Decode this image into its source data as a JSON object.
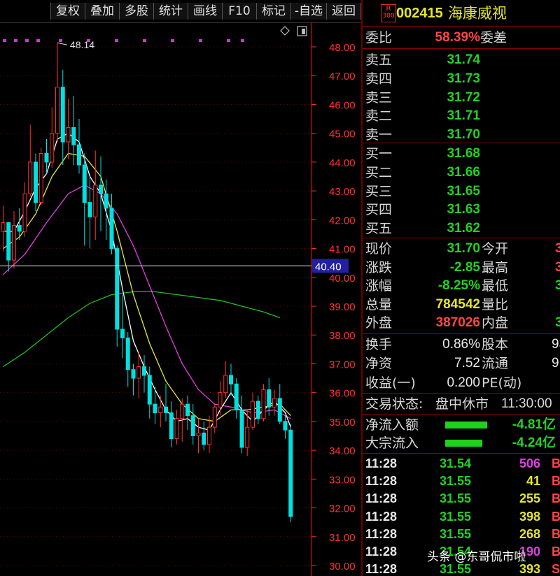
{
  "toolbar": {
    "buttons": [
      "复权",
      "叠加",
      "多股",
      "统计",
      "画线",
      "F10",
      "标记",
      "-自选",
      "返回"
    ]
  },
  "stock": {
    "badge_top": "R",
    "badge_bottom": "300",
    "code": "002415",
    "name": "海康威视"
  },
  "weibi": {
    "label": "委比",
    "value": "58.39%",
    "diff_label": "委差"
  },
  "asks": [
    {
      "label": "卖五",
      "price": "31.74"
    },
    {
      "label": "卖四",
      "price": "31.73"
    },
    {
      "label": "卖三",
      "price": "31.72"
    },
    {
      "label": "卖二",
      "price": "31.71"
    },
    {
      "label": "卖一",
      "price": "31.70"
    }
  ],
  "bids": [
    {
      "label": "买一",
      "price": "31.68"
    },
    {
      "label": "买二",
      "price": "31.66"
    },
    {
      "label": "买三",
      "price": "31.65"
    },
    {
      "label": "买四",
      "price": "31.63"
    },
    {
      "label": "买五",
      "price": "31.62"
    }
  ],
  "quote": [
    {
      "l1": "现价",
      "v1": "31.70",
      "l2": "今开",
      "v2": "3",
      "c1": "green",
      "c2": "red"
    },
    {
      "l1": "涨跌",
      "v1": "-2.85",
      "l2": "最高",
      "v2": "3",
      "c1": "green",
      "c2": "red"
    },
    {
      "l1": "涨幅",
      "v1": "-8.25%",
      "l2": "最低",
      "v2": "3",
      "c1": "green",
      "c2": "green"
    },
    {
      "l1": "总量",
      "v1": "784542",
      "l2": "量比",
      "v2": "",
      "c1": "yellow",
      "c2": "white"
    },
    {
      "l1": "外盘",
      "v1": "387026",
      "l2": "内盘",
      "v2": "39",
      "c1": "red",
      "c2": "green"
    }
  ],
  "fundamentals": [
    {
      "l1": "换手",
      "v1": "0.86%",
      "l2": "股本",
      "v2": "93"
    },
    {
      "l1": "净资",
      "v1": "7.52",
      "l2": "流通",
      "v2": "91"
    },
    {
      "l1": "收益(一)",
      "v1": "0.200",
      "l2": "PE(动)",
      "v2": ""
    }
  ],
  "status": {
    "label": "交易状态:",
    "state": "盘中休市",
    "time": "11:30:00"
  },
  "flows": [
    {
      "label": "净流入额",
      "value": "-4.81亿",
      "fill": 0.85
    },
    {
      "label": "大宗流入",
      "value": "-4.24亿",
      "fill": 0.75
    }
  ],
  "ticks": [
    {
      "time": "11:28",
      "price": "31.54",
      "vol": "506",
      "flag": "B",
      "vc": "magenta"
    },
    {
      "time": "11:28",
      "price": "31.55",
      "vol": "41",
      "flag": "B",
      "vc": "yellow"
    },
    {
      "time": "11:28",
      "price": "31.55",
      "vol": "255",
      "flag": "B",
      "vc": "yellow"
    },
    {
      "time": "11:28",
      "price": "31.55",
      "vol": "398",
      "flag": "B",
      "vc": "yellow"
    },
    {
      "time": "11:28",
      "price": "31.55",
      "vol": "268",
      "flag": "B",
      "vc": "yellow"
    },
    {
      "time": "11:28",
      "price": "31.54",
      "vol": "190",
      "flag": "B",
      "vc": "magenta"
    },
    {
      "time": "11:28",
      "price": "31.55",
      "vol": "393",
      "flag": "S",
      "vc": "yellow"
    }
  ],
  "watermark": "头条 @东哥侃市啦",
  "chart_data": {
    "type": "candlestick",
    "y_ticks": [
      "48.00",
      "47.00",
      "46.00",
      "45.00",
      "44.00",
      "43.00",
      "42.00",
      "41.00",
      "40.00",
      "39.00",
      "38.00",
      "37.00",
      "36.00",
      "35.00",
      "34.00",
      "33.00",
      "32.00",
      "31.00",
      "30.00"
    ],
    "ylim": [
      29.8,
      48.7
    ],
    "max_label": "48.14",
    "crosshair_price": 40.4,
    "crosshair_label": "40.40",
    "colors": {
      "up": "#ff3030",
      "down": "#00e0e0",
      "ma5": "#ffffff",
      "ma10": "#e8e840",
      "ma20": "#e040e0",
      "ma60": "#20c020",
      "grid": "#6b0000",
      "axis": "#ff3030"
    },
    "candles": [
      [
        41.6,
        42.5,
        40.9,
        41.9
      ],
      [
        41.9,
        41.9,
        40.2,
        40.6
      ],
      [
        40.6,
        42.3,
        40.3,
        41.8
      ],
      [
        41.8,
        42.4,
        41.3,
        41.6
      ],
      [
        41.6,
        43.3,
        41.4,
        42.9
      ],
      [
        42.9,
        45.3,
        42.8,
        44.0
      ],
      [
        44.0,
        44.3,
        42.3,
        42.6
      ],
      [
        42.6,
        44.5,
        42.5,
        44.3
      ],
      [
        44.3,
        44.8,
        43.6,
        44.0
      ],
      [
        44.0,
        45.9,
        43.8,
        45.0
      ],
      [
        45.0,
        48.14,
        44.7,
        46.6
      ],
      [
        46.6,
        47.2,
        43.9,
        44.7
      ],
      [
        44.7,
        46.2,
        44.1,
        45.2
      ],
      [
        45.2,
        46.3,
        43.9,
        44.6
      ],
      [
        44.6,
        45.5,
        43.6,
        43.9
      ],
      [
        43.9,
        44.3,
        41.1,
        42.6
      ],
      [
        42.6,
        43.5,
        41.0,
        42.1
      ],
      [
        42.1,
        44.4,
        41.3,
        43.2
      ],
      [
        43.2,
        44.2,
        41.6,
        42.9
      ],
      [
        42.9,
        43.4,
        41.3,
        42.4
      ],
      [
        42.4,
        42.9,
        40.8,
        41.0
      ],
      [
        41.0,
        41.1,
        37.6,
        38.2
      ],
      [
        38.2,
        39.4,
        37.2,
        37.9
      ],
      [
        37.9,
        38.1,
        36.2,
        36.8
      ],
      [
        36.8,
        37.0,
        35.9,
        36.5
      ],
      [
        36.5,
        37.4,
        35.8,
        36.9
      ],
      [
        36.9,
        37.3,
        36.0,
        36.6
      ],
      [
        36.6,
        36.9,
        35.1,
        35.6
      ],
      [
        35.6,
        36.2,
        34.9,
        35.3
      ],
      [
        35.3,
        35.9,
        34.8,
        35.5
      ],
      [
        35.5,
        36.3,
        35.0,
        35.3
      ],
      [
        35.3,
        35.7,
        34.1,
        34.4
      ],
      [
        34.4,
        35.4,
        34.2,
        35.1
      ],
      [
        35.1,
        35.8,
        34.3,
        35.6
      ],
      [
        35.6,
        35.9,
        34.7,
        35.2
      ],
      [
        35.2,
        35.6,
        34.2,
        34.5
      ],
      [
        34.5,
        35.1,
        33.9,
        34.6
      ],
      [
        34.6,
        35.0,
        34.0,
        34.2
      ],
      [
        34.2,
        35.2,
        33.9,
        34.8
      ],
      [
        34.8,
        35.6,
        34.6,
        35.5
      ],
      [
        35.5,
        36.4,
        35.2,
        36.0
      ],
      [
        36.0,
        37.1,
        35.8,
        36.6
      ],
      [
        36.6,
        37.0,
        35.9,
        36.3
      ],
      [
        36.3,
        36.5,
        35.1,
        35.4
      ],
      [
        35.4,
        35.9,
        33.9,
        34.1
      ],
      [
        34.1,
        35.4,
        33.8,
        34.8
      ],
      [
        34.8,
        36.0,
        34.7,
        35.7
      ],
      [
        35.7,
        35.9,
        34.9,
        35.1
      ],
      [
        35.1,
        36.3,
        35.0,
        36.1
      ],
      [
        36.1,
        36.5,
        35.2,
        35.5
      ],
      [
        35.5,
        36.1,
        35.2,
        35.8
      ],
      [
        35.8,
        36.3,
        34.9,
        35.0
      ],
      [
        35.0,
        35.2,
        34.4,
        34.7
      ],
      [
        34.7,
        34.9,
        31.5,
        31.7
      ]
    ],
    "ma5": [
      [
        0,
        41.6
      ],
      [
        2,
        41.6
      ],
      [
        4,
        42.3
      ],
      [
        6,
        43.1
      ],
      [
        8,
        43.6
      ],
      [
        10,
        44.8
      ],
      [
        12,
        45.0
      ],
      [
        14,
        44.7
      ],
      [
        16,
        43.5
      ],
      [
        18,
        42.9
      ],
      [
        20,
        41.6
      ],
      [
        22,
        39.6
      ],
      [
        24,
        37.8
      ],
      [
        26,
        36.9
      ],
      [
        28,
        36.1
      ],
      [
        30,
        35.4
      ],
      [
        32,
        35.0
      ],
      [
        34,
        35.1
      ],
      [
        36,
        34.8
      ],
      [
        38,
        34.7
      ],
      [
        40,
        35.4
      ],
      [
        42,
        36.0
      ],
      [
        44,
        35.4
      ],
      [
        46,
        35.0
      ],
      [
        48,
        35.4
      ],
      [
        50,
        35.7
      ],
      [
        52,
        35.3
      ],
      [
        53,
        34.8
      ]
    ],
    "ma10": [
      [
        0,
        41.0
      ],
      [
        3,
        41.4
      ],
      [
        6,
        42.2
      ],
      [
        9,
        43.5
      ],
      [
        12,
        44.3
      ],
      [
        15,
        44.2
      ],
      [
        18,
        43.5
      ],
      [
        21,
        41.6
      ],
      [
        24,
        39.4
      ],
      [
        27,
        37.7
      ],
      [
        30,
        36.4
      ],
      [
        33,
        35.6
      ],
      [
        36,
        35.1
      ],
      [
        39,
        35.0
      ],
      [
        42,
        35.4
      ],
      [
        45,
        35.4
      ],
      [
        48,
        35.5
      ],
      [
        51,
        35.6
      ],
      [
        53,
        35.2
      ]
    ],
    "ma20": [
      [
        0,
        40.1
      ],
      [
        4,
        40.8
      ],
      [
        8,
        41.9
      ],
      [
        12,
        42.9
      ],
      [
        15,
        43.2
      ],
      [
        18,
        42.9
      ],
      [
        21,
        42.2
      ],
      [
        24,
        41.1
      ],
      [
        27,
        39.7
      ],
      [
        30,
        38.3
      ],
      [
        33,
        37.0
      ],
      [
        36,
        36.1
      ],
      [
        39,
        35.6
      ],
      [
        42,
        35.5
      ],
      [
        46,
        35.3
      ],
      [
        50,
        35.4
      ],
      [
        53,
        35.1
      ]
    ],
    "ma60": [
      [
        0,
        36.9
      ],
      [
        4,
        37.4
      ],
      [
        8,
        38.0
      ],
      [
        12,
        38.6
      ],
      [
        16,
        39.1
      ],
      [
        20,
        39.4
      ],
      [
        24,
        39.5
      ],
      [
        28,
        39.5
      ],
      [
        32,
        39.4
      ],
      [
        36,
        39.3
      ],
      [
        40,
        39.2
      ],
      [
        44,
        39.0
      ],
      [
        48,
        38.8
      ],
      [
        51,
        38.6
      ]
    ]
  }
}
